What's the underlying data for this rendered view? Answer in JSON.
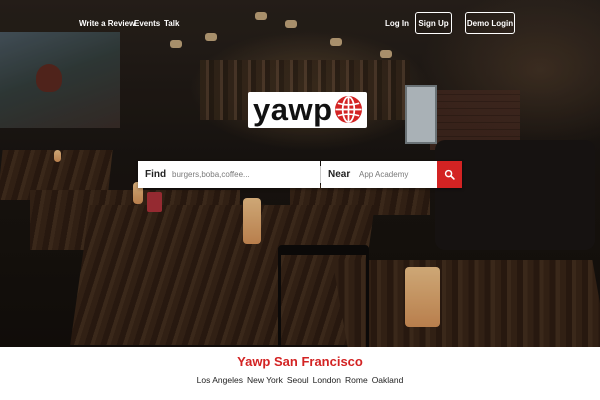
{
  "nav": {
    "write_review": "Write a Review",
    "events": "Events",
    "talk": "Talk",
    "login": "Log In",
    "signup": "Sign Up",
    "demo_login": "Demo Login"
  },
  "logo": {
    "text": "yawp",
    "icon": "globe-icon",
    "accent_color": "#d32323"
  },
  "search": {
    "find_label": "Find",
    "find_placeholder": "burgers,boba,coffee...",
    "near_label": "Near",
    "near_placeholder": "App Academy",
    "button_icon": "search-icon"
  },
  "footer": {
    "city_title": "Yawp San Francisco",
    "cities": [
      "Los Angeles",
      "New York",
      "Seoul",
      "London",
      "Rome",
      "Oakland"
    ]
  }
}
